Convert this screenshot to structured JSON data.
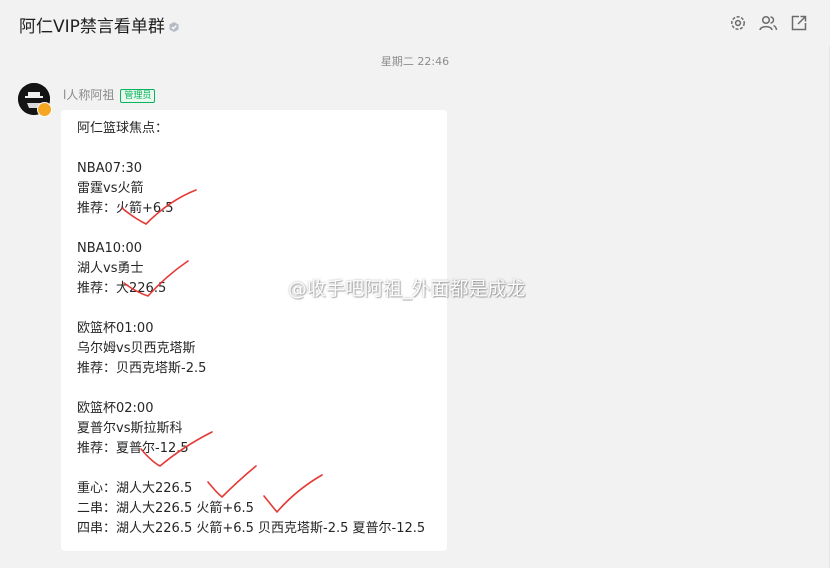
{
  "header": {
    "title": "阿仁VIP禁言看单群"
  },
  "chat": {
    "timestamp": "星期二 22:46",
    "sender": {
      "name": "l人称阿祖",
      "role": "管理员"
    },
    "message_lines": [
      "阿仁篮球焦点：",
      "",
      "NBA07:30",
      "雷霆vs火箭",
      "推荐：火箭+6.5",
      "",
      "NBA10:00",
      "湖人vs勇士",
      "推荐：大226.5",
      "",
      "欧篮杯01:00",
      "乌尔姆vs贝西克塔斯",
      "推荐：贝西克塔斯-2.5",
      "",
      "欧篮杯02:00",
      "夏普尔vs斯拉斯科",
      "推荐：夏普尔-12.5",
      "",
      "重心：湖人大226.5",
      "二串：湖人大226.5 火箭+6.5",
      "四串：湖人大226.5 火箭+6.5 贝西克塔斯-2.5 夏普尔-12.5"
    ]
  },
  "watermark": {
    "text": "@收手吧阿祖_外面都是成龙"
  },
  "icons": [
    "settings-icon",
    "group-members-icon",
    "popout-icon",
    "verified-icon",
    "weibo-logo-icon"
  ]
}
